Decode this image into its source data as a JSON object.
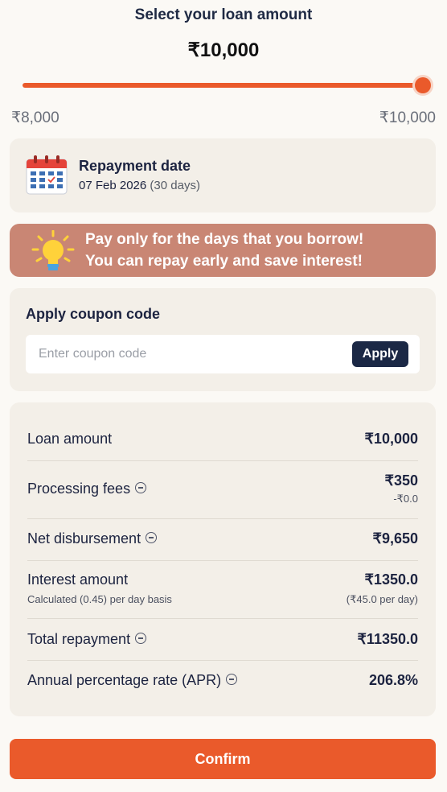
{
  "header": {
    "title": "Select your loan amount",
    "amount": "₹10,000"
  },
  "slider": {
    "min_label": "₹8,000",
    "max_label": "₹10,000",
    "value_fraction": 1.0,
    "accent_color": "#ea5a2b"
  },
  "repayment": {
    "title": "Repayment date",
    "date": "07 Feb 2026",
    "days": "(30 days)",
    "icon": "calendar-icon"
  },
  "banner": {
    "line1": "Pay only for the days that you borrow!",
    "line2": "You can repay early and save interest!",
    "icon": "lightbulb-icon",
    "color": "#c98674"
  },
  "coupon": {
    "title": "Apply coupon code",
    "placeholder": "Enter coupon code",
    "value": "",
    "apply_label": "Apply"
  },
  "summary": {
    "loan_amount": {
      "label": "Loan amount",
      "value": "₹10,000"
    },
    "processing_fees": {
      "label": "Processing fees",
      "value": "₹350",
      "sub_value": "-₹0.0"
    },
    "net_disbursement": {
      "label": "Net disbursement",
      "value": "₹9,650"
    },
    "interest_amount": {
      "label": "Interest amount",
      "sub_label": "Calculated (0.45) per day basis",
      "value": "₹1350.0",
      "sub_value": "(₹45.0 per day)"
    },
    "total_repayment": {
      "label": "Total repayment",
      "value": "₹11350.0"
    },
    "apr": {
      "label": "Annual percentage rate (APR)",
      "value": "206.8%"
    }
  },
  "confirm": {
    "label": "Confirm",
    "color": "#ea5a2b"
  }
}
